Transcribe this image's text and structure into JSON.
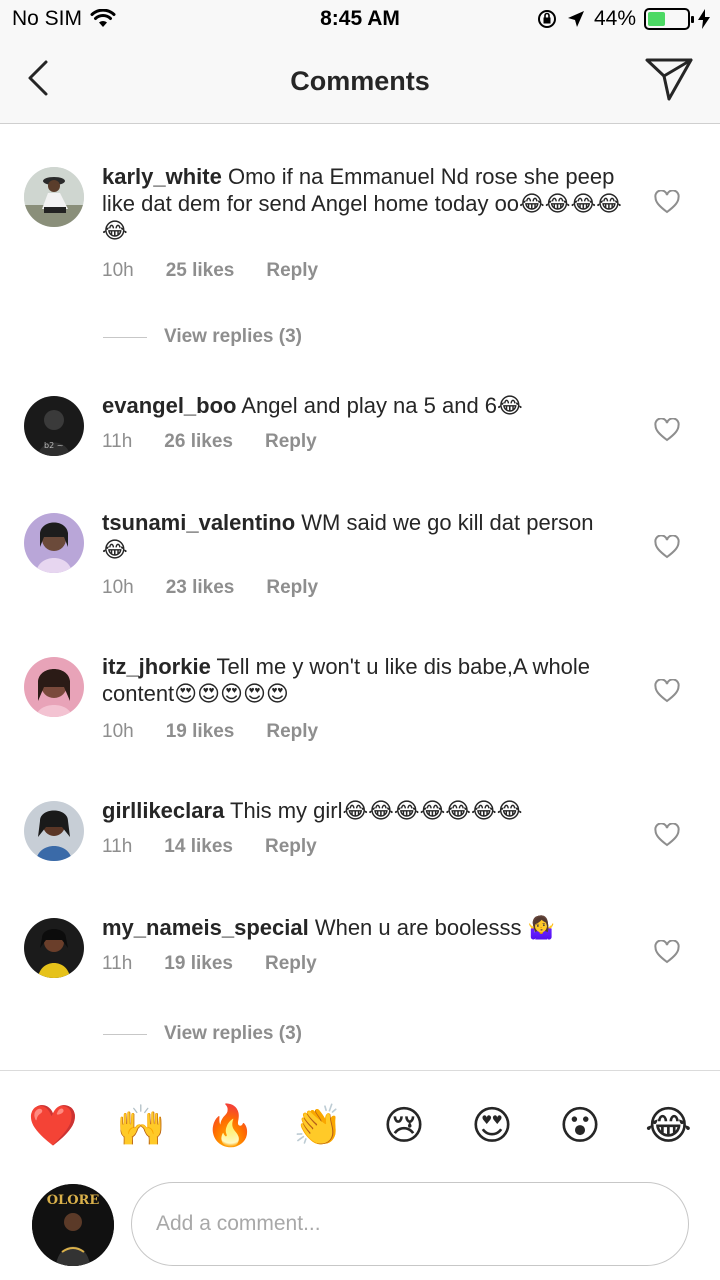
{
  "status_bar": {
    "carrier": "No SIM",
    "time": "8:45 AM",
    "battery_percent": "44%",
    "battery_level": 0.44
  },
  "header": {
    "title": "Comments"
  },
  "comments": [
    {
      "username": "karly_white",
      "text": " Omo if na Emmanuel Nd rose she peep like dat dem for send Angel home today oo😂😂😂😂😂",
      "time": "10h",
      "likes": "25 likes",
      "reply": "Reply",
      "view_replies": "View replies (3)"
    },
    {
      "username": "evangel_boo",
      "text": " Angel and play na 5 and 6😂",
      "time": "11h",
      "likes": "26 likes",
      "reply": "Reply"
    },
    {
      "username": "tsunami_valentino",
      "text": " WM said we go kill dat person 😂",
      "time": "10h",
      "likes": "23 likes",
      "reply": "Reply"
    },
    {
      "username": "itz_jhorkie",
      "text": " Tell me y won't u like dis babe,A whole content😍😍😍😍😍",
      "time": "10h",
      "likes": "19 likes",
      "reply": "Reply"
    },
    {
      "username": "girllikeclara",
      "text": " This my girl😂😂😂😂😂😂😂",
      "time": "11h",
      "likes": "14 likes",
      "reply": "Reply"
    },
    {
      "username": "my_nameis_special",
      "text": " When u are boolesss 🤷‍♀️",
      "time": "11h",
      "likes": "19 likes",
      "reply": "Reply",
      "view_replies": "View replies (3)"
    }
  ],
  "emoji_bar": [
    "❤️",
    "🙌",
    "🔥",
    "👏",
    "😢",
    "😍",
    "😮",
    "😂"
  ],
  "composer": {
    "placeholder": "Add a comment...",
    "avatar_text": "OLORE"
  },
  "colors": {
    "text": "#262626",
    "meta": "#8e8e8e",
    "divider": "#dbdbdb",
    "battery": "#4cd964"
  }
}
